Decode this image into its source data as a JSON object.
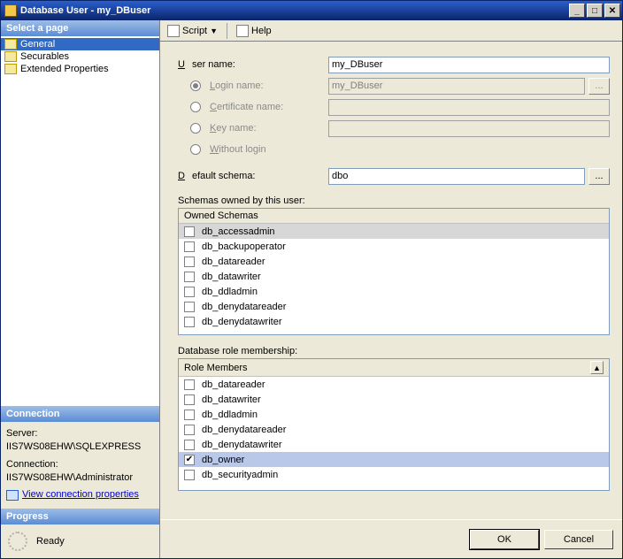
{
  "title": "Database User - my_DBuser",
  "left": {
    "select_page": "Select a page",
    "pages": [
      "General",
      "Securables",
      "Extended Properties"
    ],
    "selected_page": 0,
    "connection_hdr": "Connection",
    "server_lbl": "Server:",
    "server_val": "IIS7WS08EHW\\SQLEXPRESS",
    "conn_lbl": "Connection:",
    "conn_val": "IIS7WS08EHW\\Administrator",
    "view_conn": "View connection properties",
    "progress_hdr": "Progress",
    "progress_val": "Ready"
  },
  "toolbar": {
    "script": "Script",
    "help": "Help"
  },
  "form": {
    "user_name_lbl": "User name:",
    "user_name_val": "my_DBuser",
    "login_name_lbl": "Login name:",
    "login_name_val": "my_DBuser",
    "cert_lbl": "Certificate name:",
    "key_lbl": "Key name:",
    "without_login_lbl": "Without login",
    "default_schema_lbl": "Default schema:",
    "default_schema_val": "dbo",
    "browse": "..."
  },
  "owned": {
    "label": "Schemas owned by this user:",
    "header": "Owned Schemas",
    "items": [
      {
        "name": "db_accessadmin",
        "checked": false
      },
      {
        "name": "db_backupoperator",
        "checked": false
      },
      {
        "name": "db_datareader",
        "checked": false
      },
      {
        "name": "db_datawriter",
        "checked": false
      },
      {
        "name": "db_ddladmin",
        "checked": false
      },
      {
        "name": "db_denydatareader",
        "checked": false
      },
      {
        "name": "db_denydatawriter",
        "checked": false
      }
    ]
  },
  "roles": {
    "label": "Database role membership:",
    "header": "Role Members",
    "items": [
      {
        "name": "db_datareader",
        "checked": false
      },
      {
        "name": "db_datawriter",
        "checked": false
      },
      {
        "name": "db_ddladmin",
        "checked": false
      },
      {
        "name": "db_denydatareader",
        "checked": false
      },
      {
        "name": "db_denydatawriter",
        "checked": false
      },
      {
        "name": "db_owner",
        "checked": true
      },
      {
        "name": "db_securityadmin",
        "checked": false
      }
    ],
    "selected_index": 5
  },
  "buttons": {
    "ok": "OK",
    "cancel": "Cancel"
  }
}
